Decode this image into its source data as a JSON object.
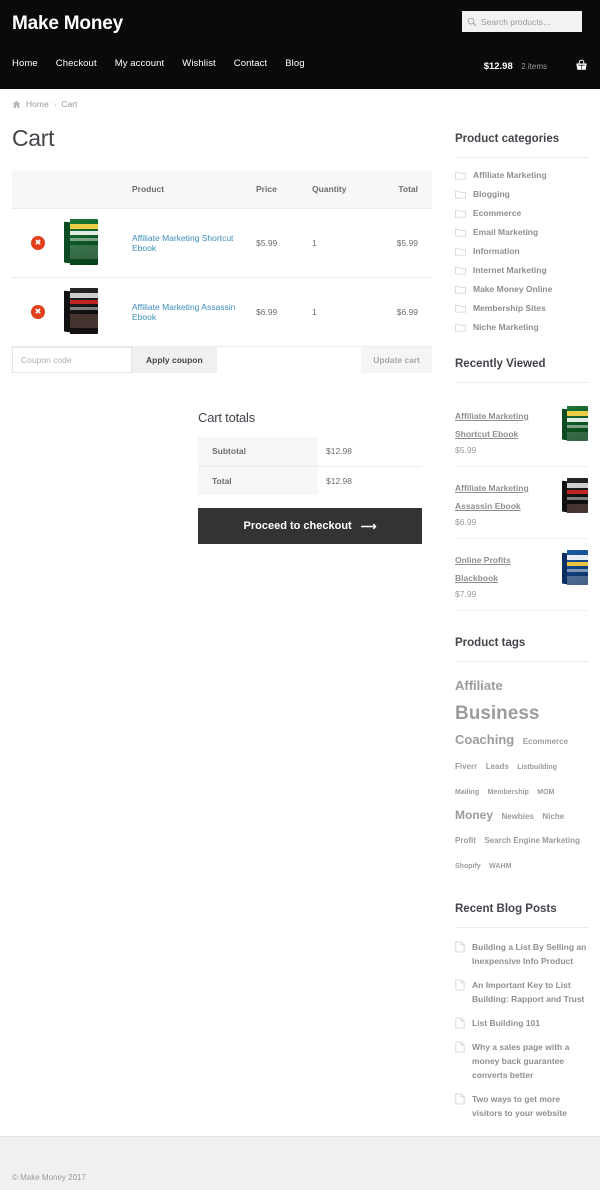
{
  "header": {
    "brand": "Make Money",
    "search": {
      "placeholder": "Search products…",
      "value": ""
    },
    "nav": [
      {
        "label": "Home"
      },
      {
        "label": "Checkout"
      },
      {
        "label": "My account"
      },
      {
        "label": "Wishlist"
      },
      {
        "label": "Contact"
      },
      {
        "label": "Blog"
      }
    ],
    "cart": {
      "amount": "$12.98",
      "count": "2 items"
    }
  },
  "breadcrumb": {
    "home": "Home",
    "separator": "›",
    "current": "Cart"
  },
  "main": {
    "page_title": "Cart",
    "table": {
      "columns": [
        "",
        "",
        "Product",
        "Price",
        "Quantity",
        "Total"
      ],
      "rows": [
        {
          "remove": "✖",
          "thumb": "book-green",
          "product": "Affiliate Marketing Shortcut Ebook",
          "price": "$5.99",
          "quantity": "1",
          "total": "$5.99"
        },
        {
          "remove": "✖",
          "thumb": "book-dark",
          "product": "Affiliate Marketing Assassin Ebook",
          "price": "$6.99",
          "quantity": "1",
          "total": "$6.99"
        }
      ]
    },
    "coupon": {
      "placeholder": "Coupon code",
      "value": "",
      "apply_label": "Apply coupon",
      "update_label": "Update cart"
    },
    "totals": {
      "title": "Cart totals",
      "rows": [
        {
          "label": "Subtotal",
          "value": "$12.98"
        },
        {
          "label": "Total",
          "value": "$12.98"
        }
      ],
      "checkout_label": "Proceed to checkout",
      "checkout_arrow": "⟶"
    }
  },
  "sidebar": {
    "categories": {
      "title": "Product categories",
      "items": [
        {
          "label": "Affiliate Marketing"
        },
        {
          "label": "Blogging"
        },
        {
          "label": "Ecommerce"
        },
        {
          "label": "Email Marketing"
        },
        {
          "label": "Information"
        },
        {
          "label": "Internet Marketing"
        },
        {
          "label": "Make Money Online"
        },
        {
          "label": "Membership Sites"
        },
        {
          "label": "Niche Marketing"
        }
      ]
    },
    "recently_viewed": {
      "title": "Recently Viewed",
      "items": [
        {
          "name": "Affiliate Marketing Shortcut Ebook",
          "price": "$5.99",
          "thumb": "book-green"
        },
        {
          "name": "Affiliate Marketing Assassin Ebook",
          "price": "$6.99",
          "thumb": "book-dark"
        },
        {
          "name": "Online Profits Blackbook",
          "price": "$7.99",
          "thumb": "book-blue"
        }
      ]
    },
    "tags": {
      "title": "Product tags",
      "items": [
        {
          "label": "Affiliate",
          "size": 13
        },
        {
          "label": "Business",
          "size": 19
        },
        {
          "label": "Coaching",
          "size": 13
        },
        {
          "label": "Ecommerce",
          "size": 8
        },
        {
          "label": "Fiverr",
          "size": 8
        },
        {
          "label": "Leads",
          "size": 8
        },
        {
          "label": "Listbuilding",
          "size": 7
        },
        {
          "label": "Mailing",
          "size": 7
        },
        {
          "label": "Membership",
          "size": 7
        },
        {
          "label": "MOM",
          "size": 7
        },
        {
          "label": "Money",
          "size": 12
        },
        {
          "label": "Newbies",
          "size": 8
        },
        {
          "label": "Niche",
          "size": 8
        },
        {
          "label": "Profit",
          "size": 8
        },
        {
          "label": "Search Engine Marketing",
          "size": 8
        },
        {
          "label": "Shopify",
          "size": 7
        },
        {
          "label": "WAHM",
          "size": 7
        }
      ]
    },
    "blog": {
      "title": "Recent Blog Posts",
      "items": [
        {
          "label": "Building a List By Selling an Inexpensive Info Product"
        },
        {
          "label": "An Important Key to List Building: Rapport and Trust"
        },
        {
          "label": "List Building 101"
        },
        {
          "label": "Why a sales page with a money back guarantee converts better"
        },
        {
          "label": "Two ways to get more visitors to your website"
        }
      ]
    }
  },
  "footer": {
    "credit": "© Make Money 2017"
  },
  "colors": {
    "header_bg": "#0a0a0a",
    "link_blue": "#3c8dbc",
    "remove_red": "#e2401c",
    "checkout_bg": "#333333",
    "table_head_bg": "#f7f7f7",
    "footer_bg": "#f0f0f0"
  }
}
